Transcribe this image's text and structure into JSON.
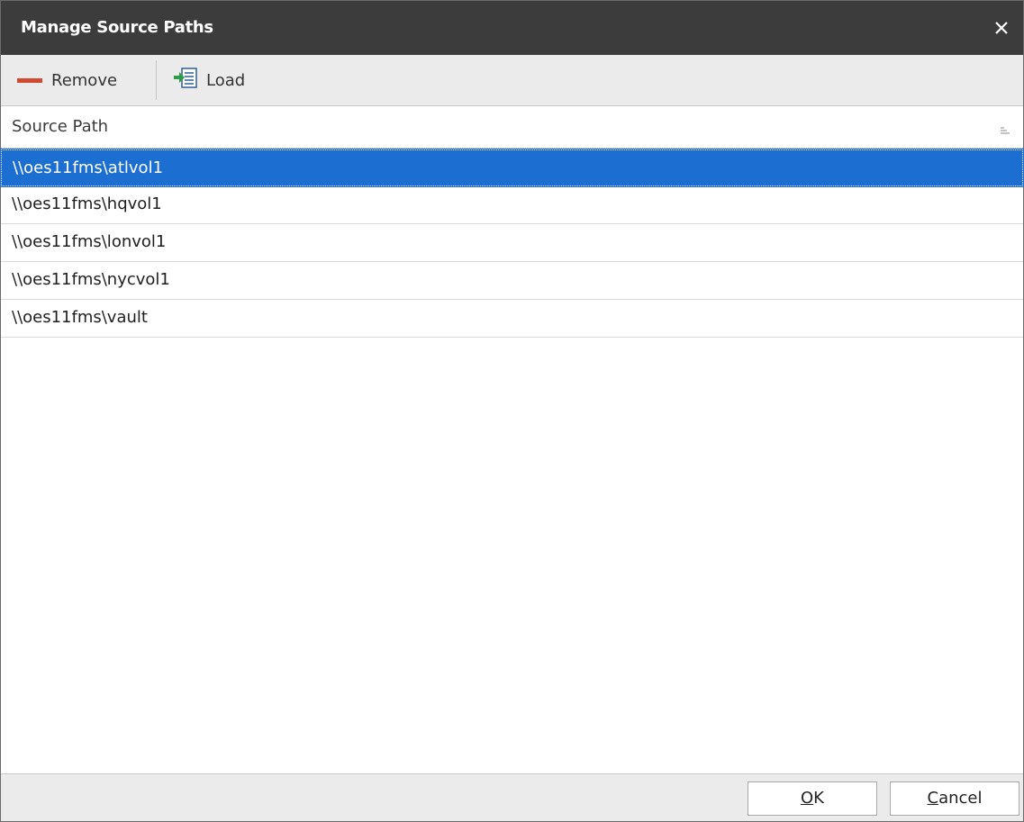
{
  "dialog": {
    "title": "Manage Source Paths",
    "close_icon": "close-icon"
  },
  "toolbar": {
    "remove_label": "Remove",
    "remove_icon": "minus-icon",
    "load_label": "Load",
    "load_icon": "load-list-icon"
  },
  "grid": {
    "column_header": "Source Path",
    "sort_icon": "column-sort-icon",
    "rows": [
      {
        "path": "\\\\oes11fms\\atlvol1",
        "selected": true
      },
      {
        "path": "\\\\oes11fms\\hqvol1",
        "selected": false
      },
      {
        "path": "\\\\oes11fms\\lonvol1",
        "selected": false
      },
      {
        "path": "\\\\oes11fms\\nycvol1",
        "selected": false
      },
      {
        "path": "\\\\oes11fms\\vault",
        "selected": false
      }
    ]
  },
  "footer": {
    "ok_label": "OK",
    "cancel_label": "Cancel"
  },
  "colors": {
    "titlebar": "#3c3c3c",
    "selection": "#1c6fd0",
    "remove_accent": "#d24a2f",
    "load_accent": "#2e9b4a"
  }
}
